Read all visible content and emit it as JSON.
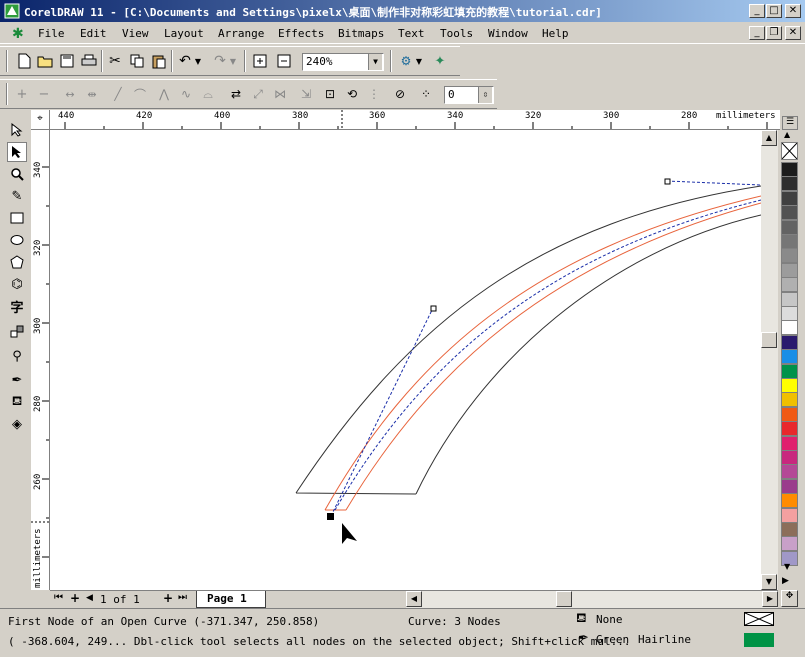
{
  "window": {
    "title": "CorelDRAW 11 - [C:\\Documents and Settings\\pixelx\\桌面\\制作非对称彩虹填充的教程\\tutorial.cdr]"
  },
  "menu": {
    "items": [
      {
        "label": "File"
      },
      {
        "label": "Edit"
      },
      {
        "label": "View"
      },
      {
        "label": "Layout"
      },
      {
        "label": "Arrange"
      },
      {
        "label": "Effects"
      },
      {
        "label": "Bitmaps"
      },
      {
        "label": "Text"
      },
      {
        "label": "Tools"
      },
      {
        "label": "Window"
      },
      {
        "label": "Help"
      }
    ]
  },
  "toolbar": {
    "zoom_value": "240%"
  },
  "propertybar": {
    "nudge_value": "0"
  },
  "rulers": {
    "unit": "millimeters",
    "horizontal_ticks": [
      "440",
      "420",
      "400",
      "380",
      "360",
      "340",
      "320",
      "300",
      "280"
    ],
    "vertical_ticks": [
      "340",
      "320",
      "300",
      "280",
      "260"
    ]
  },
  "pages": {
    "counter": "1 of 1",
    "tab_label": "Page 1"
  },
  "status": {
    "hint": "First Node of an Open Curve (-371.347, 250.858)",
    "curve_info": "Curve: 3 Nodes",
    "fill_label": "None",
    "outline_color_label": "Green",
    "outline_width_label": "Hairline",
    "coords_hint": "( -368.604, 249... Dbl-click tool selects all nodes on the selected object; Shift+click mul..."
  },
  "colors": {
    "title_start": "#0a246a",
    "title_end": "#a6caf0",
    "outline_green": "#009346",
    "curve_orange": "#e8643c",
    "path_blue": "#1a2ea8"
  },
  "palette": [
    "#1c1c1c",
    "#2e2e2e",
    "#404040",
    "#525252",
    "#636363",
    "#767676",
    "#8a8a8a",
    "#9c9c9c",
    "#b0b0b0",
    "#c6c6c6",
    "#dcdcdc",
    "#ffffff",
    "#2a1a6e",
    "#1a8ee6",
    "#00924a",
    "#ffff00",
    "#f0c000",
    "#f05a14",
    "#e8282c",
    "#e0206e",
    "#c8287e",
    "#b44896",
    "#9a3c8c",
    "#ff8c00",
    "#f4a0a0",
    "#8c6e5a",
    "#c8a0c8",
    "#a098c8"
  ]
}
